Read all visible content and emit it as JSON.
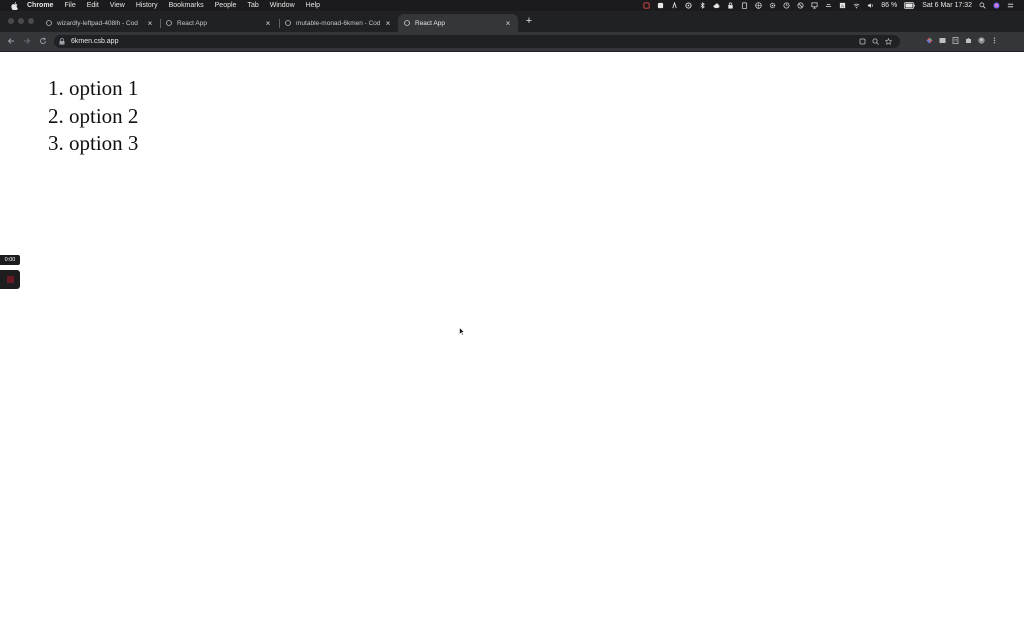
{
  "menubar": {
    "app_name": "Chrome",
    "menus": [
      "File",
      "Edit",
      "View",
      "History",
      "Bookmarks",
      "People",
      "Tab",
      "Window",
      "Help"
    ],
    "battery": "86 %",
    "clock": "Sat 6 Mar  17:32"
  },
  "tabs": [
    {
      "title": "wizardly-leftpad-408lh - Cod",
      "active": false
    },
    {
      "title": "React App",
      "active": false
    },
    {
      "title": "mutable-monad-6kmen - Cod",
      "active": false
    },
    {
      "title": "React App",
      "active": true
    }
  ],
  "omnibox": {
    "url": "6kmen.csb.app"
  },
  "page": {
    "options": [
      "1. option 1",
      "2. option 2",
      "3. option 3"
    ]
  },
  "recorder": {
    "time": "0:00"
  },
  "colors": {
    "chrome_dark": "#202124",
    "toolbar": "#35363a",
    "menubar": "#1b1b1d",
    "page_bg": "#ffffff"
  }
}
